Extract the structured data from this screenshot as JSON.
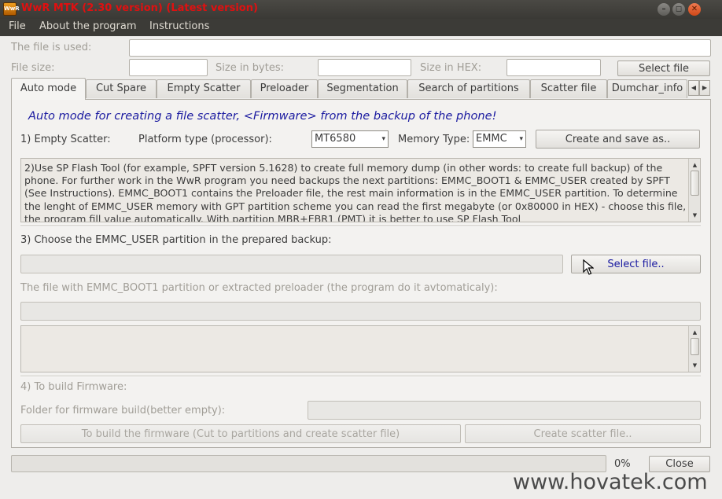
{
  "window": {
    "app_icon_label": "WwR",
    "title": "WwR MTK (2.30 version) (Latest version)",
    "controls": {
      "minimize": "–",
      "maximize": "◻",
      "close": "✕"
    }
  },
  "menu": [
    {
      "label": "File"
    },
    {
      "label": "About the program"
    },
    {
      "label": "Instructions"
    }
  ],
  "file_info": {
    "file_used_label": "The file is used:",
    "file_used_value": "",
    "file_size_label": "File size:",
    "file_size_value": "",
    "size_bytes_label": "Size in bytes:",
    "size_bytes_value": "",
    "size_hex_label": "Size in HEX:",
    "size_hex_value": "",
    "select_file_button": "Select file"
  },
  "tabs": [
    {
      "label": "Auto mode",
      "active": true
    },
    {
      "label": "Cut Spare"
    },
    {
      "label": "Empty Scatter"
    },
    {
      "label": "Preloader"
    },
    {
      "label": "Segmentation"
    },
    {
      "label": "Search of partitions"
    },
    {
      "label": "Scatter file"
    },
    {
      "label": "Dumchar_info"
    }
  ],
  "tab_scroll": {
    "left": "◀",
    "right": "▶"
  },
  "auto_mode": {
    "heading": "Auto mode for creating a file scatter, <Firmware> from the backup of the phone!",
    "step1_label": "1) Empty Scatter:",
    "platform_label": "Platform type (processor):",
    "platform_value": "MT6580",
    "memory_label": "Memory Type:",
    "memory_value": "EMMC",
    "create_save_button": "Create and save as..",
    "info_text": "2)Use SP Flash Tool (for example, SPFT version 5.1628) to create full memory dump (in other words: to create full backup) of the phone. For further work in the WwR program you need backups the next partitions: EMMC_BOOT1 & EMMC_USER created by SPFT (See Instructions). EMMC_BOOT1 contains the Preloader file, the rest main information is in the EMMC_USER partition. To determine the lenght of EMMC_USER memory with GPT partition scheme you can read the first megabyte (or 0x80000 in HEX) - choose this file, the program fill value automatically. With partition MBR+EBR1 (PMT) it is better to use SP Flash Tool",
    "step3_label": "3) Choose the EMMC_USER partition in the prepared backup:",
    "emmc_user_path": "",
    "select_file_button": "Select file..",
    "boot1_label": "The file with EMMC_BOOT1 partition or extracted preloader (the program do it avtomaticaly):",
    "boot1_path": "",
    "log_text": "",
    "step4_label": "4) To build Firmware:",
    "folder_label": "Folder for firmware build(better empty):",
    "folder_value": "",
    "build_button": "To build the firmware (Cut to partitions and create scatter file)",
    "create_scatter_button": "Create scatter file.."
  },
  "footer": {
    "progress_percent": 0,
    "progress_label": "0%",
    "close_button": "Close"
  },
  "watermark": "www.hovatek.com",
  "icons": {
    "dropdown": "▾",
    "scroll_up": "▲",
    "scroll_down": "▼"
  }
}
